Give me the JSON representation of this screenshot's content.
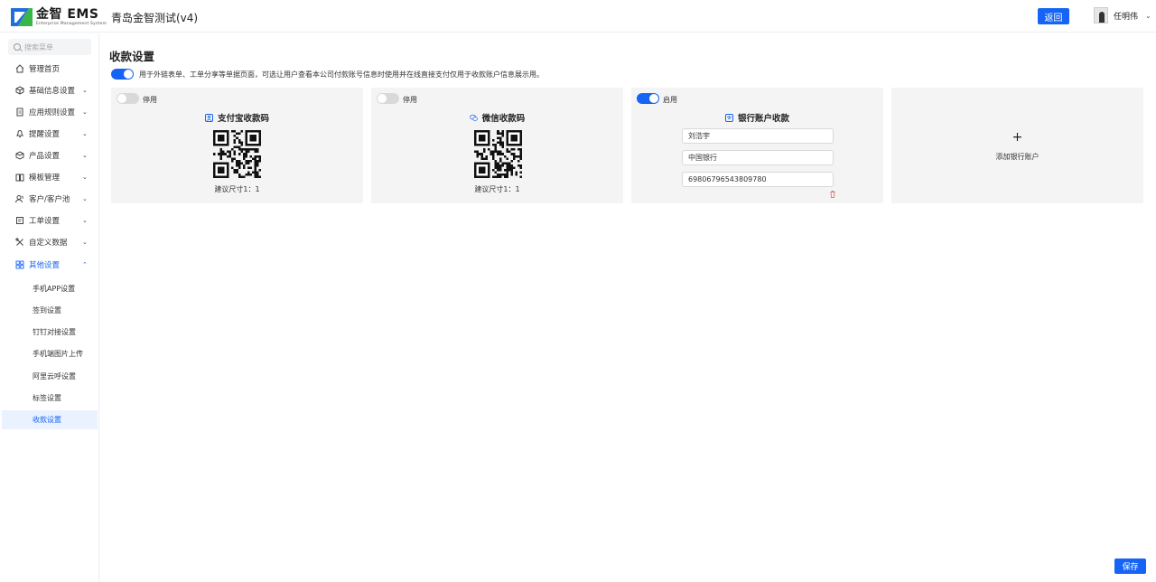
{
  "header": {
    "logo_text": "金智 EMS",
    "logo_sub": "Enterprise Management System",
    "company": "青岛金智测试(v4)",
    "back_label": "返回",
    "user_name": "任明伟"
  },
  "sidebar": {
    "search_placeholder": "搜索菜单",
    "items": [
      {
        "label": "管理首页",
        "icon": "home-icon"
      },
      {
        "label": "基础信息设置",
        "icon": "cube-icon"
      },
      {
        "label": "应用规则设置",
        "icon": "document-icon"
      },
      {
        "label": "提醒设置",
        "icon": "bell-icon"
      },
      {
        "label": "产品设置",
        "icon": "box-icon"
      },
      {
        "label": "模板管理",
        "icon": "book-icon"
      },
      {
        "label": "客户/客户池",
        "icon": "users-icon"
      },
      {
        "label": "工单设置",
        "icon": "ticket-icon"
      },
      {
        "label": "自定义数据",
        "icon": "tools-icon"
      },
      {
        "label": "其他设置",
        "icon": "grid-icon"
      }
    ],
    "sub_items": [
      "手机APP设置",
      "签到设置",
      "钉钉对接设置",
      "手机端图片上传",
      "阿里云呼设置",
      "标签设置",
      "收款设置"
    ]
  },
  "main": {
    "title": "收款设置",
    "description": "用于外链表单、工单分享等单据页面，可选让用户查看本公司付款账号信息时使用并在线直接支付仅用于收款账户信息展示用。",
    "cards": [
      {
        "status": "停用",
        "enabled": false,
        "title": "支付宝收款码",
        "hint": "建议尺寸1：1"
      },
      {
        "status": "停用",
        "enabled": false,
        "title": "微信收款码",
        "hint": "建议尺寸1：1"
      },
      {
        "status": "启用",
        "enabled": true,
        "title": "银行账户收款",
        "fields": {
          "name": "刘浩宇",
          "bank": "中国银行",
          "account": "69806796543809780"
        }
      }
    ],
    "add_label": "添加银行账户",
    "save_label": "保存"
  },
  "colors": {
    "accent": "#1664f5",
    "card_bg": "#f4f4f4"
  }
}
